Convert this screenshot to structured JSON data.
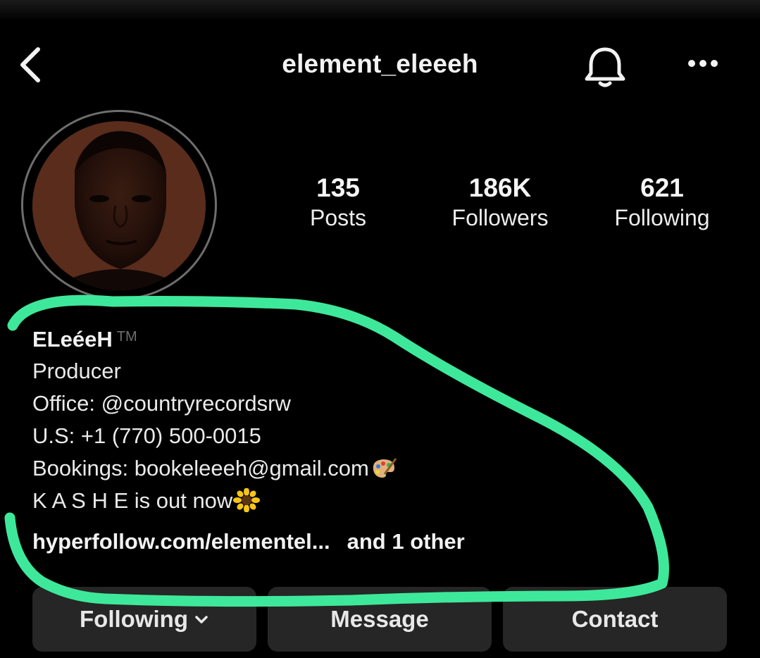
{
  "header": {
    "username": "element_eleeeh",
    "back_icon": "chevron-left-icon",
    "bell_icon": "bell-icon",
    "more_icon": "more-horizontal-icon"
  },
  "stats": [
    {
      "value": "135",
      "label": "Posts"
    },
    {
      "value": "186K",
      "label": "Followers"
    },
    {
      "value": "621",
      "label": "Following"
    }
  ],
  "bio": {
    "display_name": "ELeéeH",
    "trademark": "TM",
    "lines": [
      "Producer",
      "Office: @countryrecordsrw",
      "U.S: +1 (770) 500-0015",
      "Bookings: bookeleeeh@gmail.com",
      "K A S H E is out now"
    ],
    "link": "hyperfollow.com/elementel...",
    "link_more": "and 1 other"
  },
  "actions": {
    "following": "Following",
    "message": "Message",
    "contact": "Contact"
  },
  "colors": {
    "background": "#000000",
    "button_bg": "#262626",
    "highlight_marker": "#3ee89a"
  }
}
